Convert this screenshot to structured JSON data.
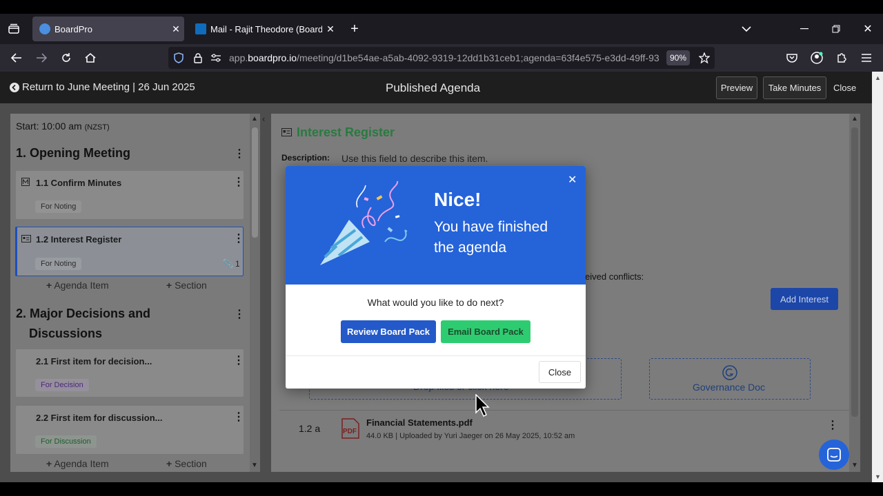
{
  "browser": {
    "tabs": [
      {
        "title": "BoardPro",
        "active": true
      },
      {
        "title": "Mail - Rajit Theodore (BoardPro",
        "active": false
      }
    ],
    "url_prefix": "app.",
    "url_domain": "boardpro.io",
    "url_rest": "/meeting/d1be54ae-a5ab-4092-9319-12dd1b31ceb1;agenda=63f4e575-e3dd-49ff-93",
    "zoom": "90%"
  },
  "header": {
    "back_link": "Return to June Meeting | 26 Jun 2025",
    "title": "Published Agenda",
    "preview": "Preview",
    "take_minutes": "Take Minutes",
    "close": "Close"
  },
  "sidebar": {
    "start_label": "Start: 10:00 am",
    "timezone": "(NZST)",
    "section1_title": "1. Opening Meeting",
    "item_1_1": {
      "title": "1.1 Confirm Minutes",
      "tag": "For Noting"
    },
    "item_1_2": {
      "title": "1.2 Interest Register",
      "tag": "For Noting",
      "attachments": "1"
    },
    "add_agenda_item": "Agenda Item",
    "add_section": "Section",
    "section2_title_line1": "2. Major Decisions and",
    "section2_title_line2": "Discussions",
    "item_2_1": {
      "title": "2.1 First item for decision...",
      "tag": "For Decision"
    },
    "item_2_2": {
      "title": "2.2 First item for discussion...",
      "tag": "For Discussion"
    }
  },
  "main": {
    "item_title": "Interest Register",
    "description_label": "Description:",
    "description_value": "Use this field to describe this item.",
    "conflicts_fragment": "eived conflicts:",
    "add_interest": "Add Interest",
    "drop_files": "Drop files or click here",
    "governance_doc": "Governance Doc",
    "file": {
      "number": "1.2 a",
      "name": "Financial Statements.pdf",
      "meta": "44.0 KB | Uploaded by Yuri Jaeger on 26 May 2025, 10:52 am"
    }
  },
  "modal": {
    "heading": "Nice!",
    "subheading_line1": "You have finished",
    "subheading_line2": "the agenda",
    "question": "What would you like to do next?",
    "review_button": "Review Board Pack",
    "email_button": "Email Board Pack",
    "close_button": "Close"
  },
  "colors": {
    "brand_blue": "#2563d9",
    "green": "#2ecc71",
    "interest_green": "#2a9d4a"
  }
}
